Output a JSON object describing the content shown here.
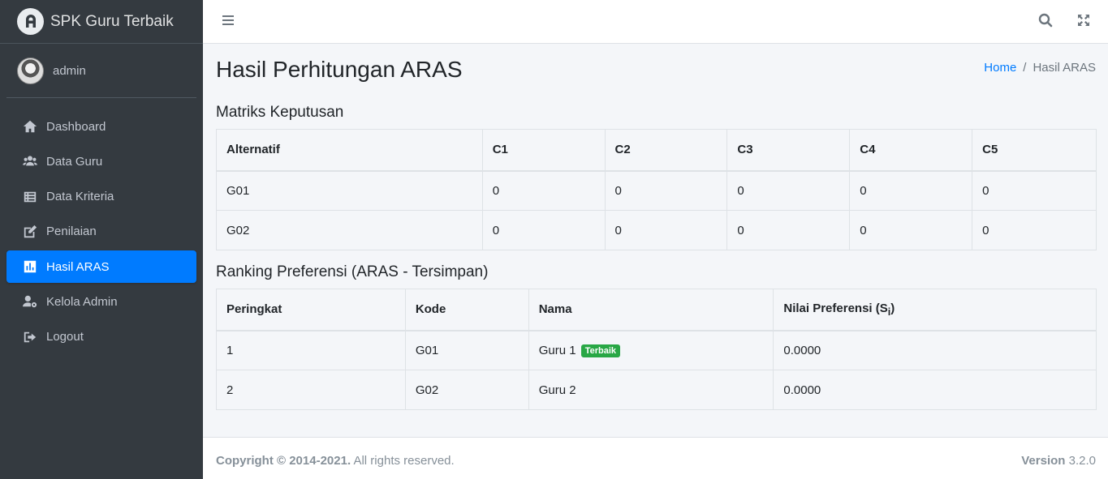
{
  "brand": {
    "title": "SPK Guru Terbaik",
    "logo_icon": "adminlte-logo-icon"
  },
  "user": {
    "name": "admin"
  },
  "sidebar": {
    "items": [
      {
        "label": "Dashboard",
        "icon": "home-icon"
      },
      {
        "label": "Data Guru",
        "icon": "users-icon"
      },
      {
        "label": "Data Kriteria",
        "icon": "list-icon"
      },
      {
        "label": "Penilaian",
        "icon": "edit-icon"
      },
      {
        "label": "Hasil ARAS",
        "icon": "chart-bar-icon",
        "active": true
      },
      {
        "label": "Kelola Admin",
        "icon": "user-cog-icon"
      },
      {
        "label": "Logout",
        "icon": "sign-out-icon"
      }
    ]
  },
  "navbar": {
    "menu_icon": "bars-icon",
    "search_icon": "search-icon",
    "fullscreen_icon": "expand-icon"
  },
  "page": {
    "title": "Hasil Perhitungan ARAS",
    "breadcrumb": {
      "home": "Home",
      "separator": "/",
      "current": "Hasil ARAS"
    }
  },
  "matrix": {
    "title": "Matriks Keputusan",
    "headers": [
      "Alternatif",
      "C1",
      "C2",
      "C3",
      "C4",
      "C5"
    ],
    "rows": [
      [
        "G01",
        "0",
        "0",
        "0",
        "0",
        "0"
      ],
      [
        "G02",
        "0",
        "0",
        "0",
        "0",
        "0"
      ]
    ]
  },
  "ranking": {
    "title": "Ranking Preferensi (ARAS - Tersimpan)",
    "headers": {
      "rank": "Peringkat",
      "code": "Kode",
      "name": "Nama",
      "value": "Nilai Preferensi (S",
      "value_sub": "i",
      "value_close": ")"
    },
    "rows": [
      {
        "rank": "1",
        "code": "G01",
        "name": "Guru 1",
        "badge": "Terbaik",
        "value": "0.0000"
      },
      {
        "rank": "2",
        "code": "G02",
        "name": "Guru 2",
        "badge": "",
        "value": "0.0000"
      }
    ]
  },
  "footer": {
    "copyright": "Copyright © 2014-2021.",
    "rights": "All rights reserved.",
    "version_label": "Version",
    "version": "3.2.0"
  },
  "colors": {
    "sidebar_bg": "#343a40",
    "active": "#007bff",
    "badge": "#28a745"
  }
}
